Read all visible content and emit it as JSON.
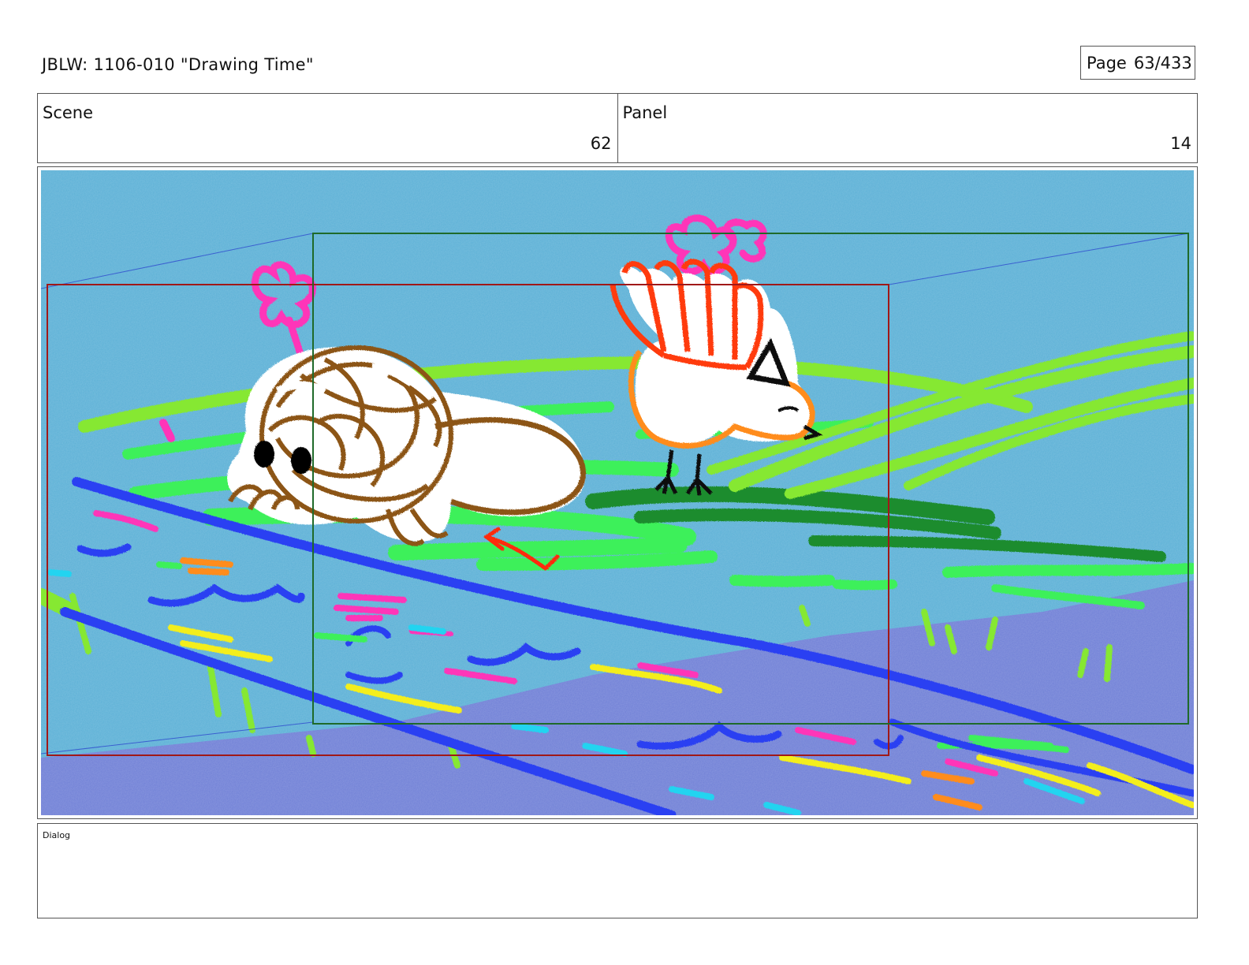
{
  "header": {
    "title": "JBLW: 1106-010 \"Drawing Time\"",
    "page_label": "Page",
    "page_value": "63/433"
  },
  "info": {
    "scene_label": "Scene",
    "scene_value": "62",
    "panel_label": "Panel",
    "panel_value": "14"
  },
  "dialog": {
    "label": "Dialog"
  },
  "colors": {
    "sky": "#5bb0d6",
    "water_purple": "#6f7fd6",
    "lime": "#86e830",
    "bright_green": "#3df05a",
    "dark_green": "#1f8c2e",
    "blue_stroke": "#2a3ff2",
    "pink": "#ff35b8",
    "brown": "#8c5514",
    "orange": "#ff8c1a",
    "red_orange": "#ff3a10",
    "frame_red": "#a01818",
    "frame_green": "#1f6a2a"
  }
}
